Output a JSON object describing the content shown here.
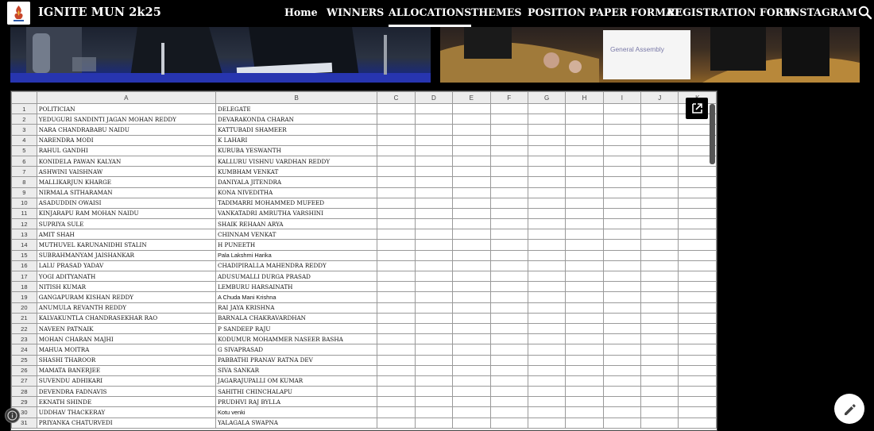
{
  "site": {
    "title": "IGNITE MUN 2k25"
  },
  "nav": {
    "items": [
      {
        "label": "Home",
        "active": false
      },
      {
        "label": "WINNERS",
        "active": false
      },
      {
        "label": "ALLOCATIONS",
        "active": true
      },
      {
        "label": "THEMES",
        "active": false
      },
      {
        "label": "POSITION PAPER FORMAT",
        "active": false
      },
      {
        "label": "REGISTRATION FORM",
        "active": false
      },
      {
        "label": "INSTAGRAM",
        "active": false
      }
    ]
  },
  "banner": {
    "right_sign_text": "General Assembly"
  },
  "sheet": {
    "columns": [
      "A",
      "B",
      "C",
      "D",
      "E",
      "F",
      "G",
      "H",
      "I",
      "J",
      "K"
    ],
    "rows": [
      {
        "n": "1",
        "a": "POLITICIAN",
        "b": "DELEGATE"
      },
      {
        "n": "2",
        "a": "YEDUGURI SANDINTI JAGAN MOHAN REDDY",
        "b": "DEVARAKONDA CHARAN"
      },
      {
        "n": "3",
        "a": "NARA CHANDRABABU NAIDU",
        "b": "KATTUBADI SHAMEER"
      },
      {
        "n": "4",
        "a": "NARENDRA MODI",
        "b": "K LAHARI"
      },
      {
        "n": "5",
        "a": "RAHUL GANDHI",
        "b": "KURUBA YESWANTH"
      },
      {
        "n": "6",
        "a": "KONIDELA PAWAN KALYAN",
        "b": "KALLURU VISHNU VARDHAN REDDY"
      },
      {
        "n": "7",
        "a": "ASHWINI VAISHNAW",
        "b": "KUMBHAM VENKAT"
      },
      {
        "n": "8",
        "a": "MALLIKARJUN KHARGE",
        "b": "DANIYALA JITENDRA"
      },
      {
        "n": "9",
        "a": "NIRMALA SITHARAMAN",
        "b": "KONA NIVEDITHA"
      },
      {
        "n": "10",
        "a": "ASADUDDIN OWAISI",
        "b": "TADIMARRI MOHAMMED MUFEED"
      },
      {
        "n": "11",
        "a": "KINJARAPU RAM MOHAN NAIDU",
        "b": "VANKATADRI AMRUTHA VARSHINI"
      },
      {
        "n": "12",
        "a": "SUPRIYA SULE",
        "b": "SHAIK REHAAN ARYA"
      },
      {
        "n": "13",
        "a": "AMIT SHAH",
        "b": "CHINNAM VENKAT"
      },
      {
        "n": "14",
        "a": "MUTHUVEL KARUNANIDHI STALIN",
        "b": "H PUNEETH"
      },
      {
        "n": "15",
        "a": "SUBRAHMANYAM JAISHANKAR",
        "b": "Pala Lakshmi Harika",
        "b_sans": true
      },
      {
        "n": "16",
        "a": "LALU PRASAD YADAV",
        "b": "CHADIPIRALLA MAHENDRA REDDY"
      },
      {
        "n": "17",
        "a": "YOGI ADITYANATH",
        "b": "ADUSUMALLI DURGA PRASAD"
      },
      {
        "n": "18",
        "a": "NITISH KUMAR",
        "b": "LEMBURU HARSAINATH"
      },
      {
        "n": "19",
        "a": "GANGAPURAM KISHAN REDDY",
        "b": "A Chuda Mani Krishna",
        "b_sans": true
      },
      {
        "n": "20",
        "a": "ANUMULA REVANTH REDDY",
        "b": "RAI JAYA KRISHNA"
      },
      {
        "n": "21",
        "a": "KALVAKUNTLA CHANDRASEKHAR RAO",
        "b": "BARNALA CHAKRAVARDHAN"
      },
      {
        "n": "22",
        "a": "NAVEEN PATNAIK",
        "b": "P SANDEEP RAJU"
      },
      {
        "n": "23",
        "a": "MOHAN CHARAN MAJHI",
        "b": "KODUMUR MOHAMMER NASEER BASHA"
      },
      {
        "n": "24",
        "a": "MAHUA MOITRA",
        "b": "G SIVAPRASAD"
      },
      {
        "n": "25",
        "a": "SHASHI THAROOR",
        "b": "PABBATHI PRANAV RATNA DEV"
      },
      {
        "n": "26",
        "a": "MAMATA BANERJEE",
        "b": "SIVA SANKAR"
      },
      {
        "n": "27",
        "a": "SUVENDU ADHIKARI",
        "b": "JAGARAJUPALLI OM KUMAR"
      },
      {
        "n": "28",
        "a": "DEVENDRA FADNAVIS",
        "b": "SAHITHI CHINCHALAPU"
      },
      {
        "n": "29",
        "a": "EKNATH SHINDE",
        "b": "PRUDHVI RAJ BYLLA"
      },
      {
        "n": "30",
        "a": "UDDHAV THACKERAY",
        "b": "Kotu venki",
        "b_sans": true
      },
      {
        "n": "31",
        "a": "PRIYANKA CHATURVEDI",
        "b": "YALAGALA SWAPNA"
      }
    ]
  },
  "icons": {
    "search": "search-icon",
    "open_new": "open-in-new-icon",
    "edit": "pencil-icon",
    "info": "info-icon"
  }
}
